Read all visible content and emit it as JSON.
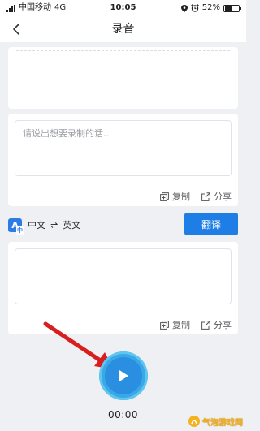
{
  "status_bar": {
    "carrier": "中国移动",
    "network": "4G",
    "time": "10:05",
    "battery": "52%",
    "battery_level": 0.52
  },
  "nav": {
    "title": "录音",
    "back_icon": "chevron-left-icon"
  },
  "source_card": {
    "placeholder": "请说出想要录制的话..",
    "copy_label": "复制",
    "share_label": "分享"
  },
  "lang_bar": {
    "icon_letter": "A",
    "icon_sub": "中",
    "source_lang": "中文",
    "swap_symbol": "⇌",
    "target_lang": "英文",
    "translate_label": "翻译"
  },
  "target_card": {
    "copy_label": "复制",
    "share_label": "分享"
  },
  "recorder": {
    "timer": "00:00"
  },
  "colors": {
    "accent": "#1e7ee6",
    "record_button": "#3aa7e6",
    "arrow": "#d81e1e",
    "background": "#eef0f4"
  },
  "watermark": {
    "text": "气泡游戏网"
  }
}
